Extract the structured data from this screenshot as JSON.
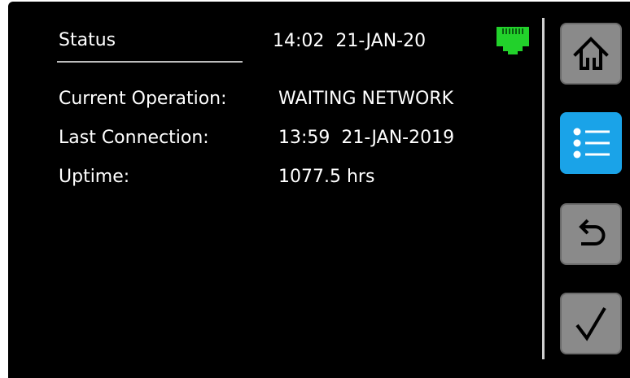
{
  "header": {
    "title": "Status",
    "clock": "14:02  21-JAN-20"
  },
  "status": {
    "current_operation_label": "Current Operation:",
    "current_operation_value": "WAITING NETWORK",
    "last_connection_label": "Last Connection:",
    "last_connection_value": "13:59  21-JAN-2019",
    "uptime_label": "Uptime:",
    "uptime_value": "1077.5 hrs"
  },
  "icons": {
    "network": "ethernet-connected-icon",
    "home": "home-icon",
    "menu": "list-icon",
    "back": "back-arrow-icon",
    "confirm": "checkmark-icon"
  },
  "colors": {
    "background": "#000000",
    "text": "#ffffff",
    "network_ok": "#22d12b",
    "button": "#8a8a8a",
    "button_active": "#1aa3e8"
  }
}
